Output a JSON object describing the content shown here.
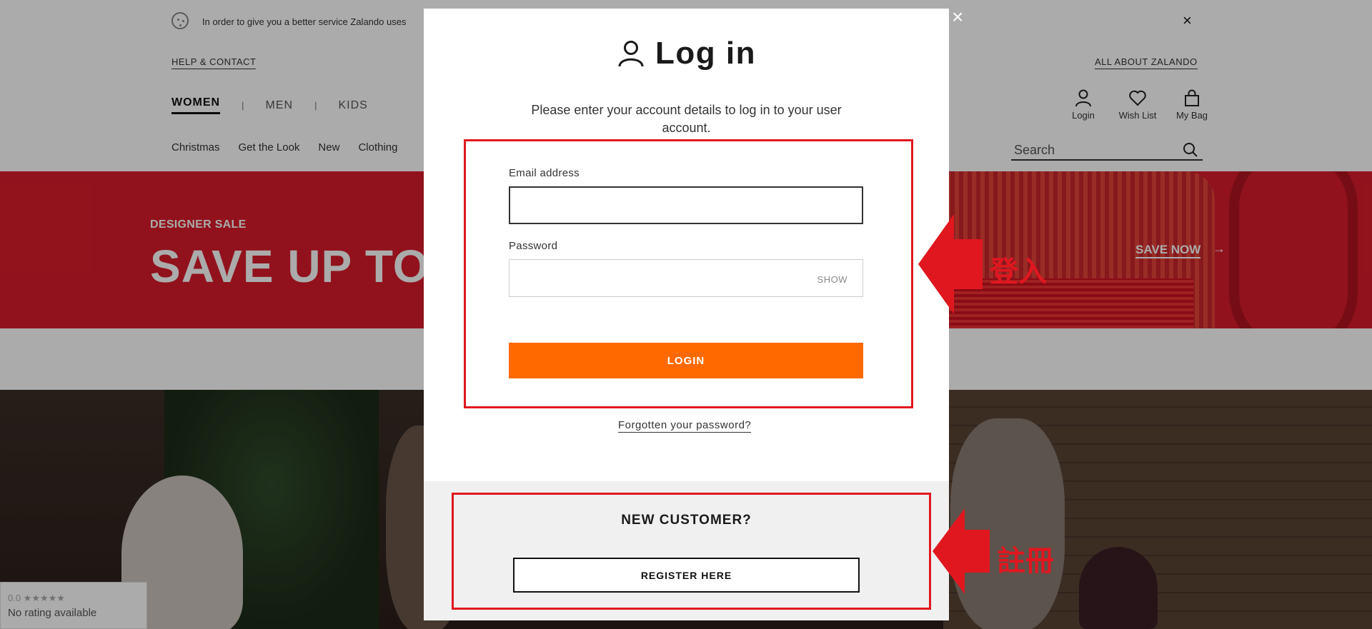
{
  "cookie": {
    "text": "In order to give you a better service Zalando uses"
  },
  "top_links": {
    "help": "HELP & CONTACT",
    "about": "ALL ABOUT ZALANDO"
  },
  "gender_tabs": [
    "WOMEN",
    "MEN",
    "KIDS"
  ],
  "separator": "|",
  "categories": [
    "Christmas",
    "Get the Look",
    "New",
    "Clothing"
  ],
  "header_icons": {
    "login": "Login",
    "wishlist": "Wish List",
    "bag": "My Bag"
  },
  "search": {
    "placeholder": "Search"
  },
  "banner": {
    "subtitle": "DESIGNER SALE",
    "title": "SAVE UP TO",
    "cta": "SAVE NOW",
    "cta_arrow": "→"
  },
  "rating": {
    "score": "0.0 ★★★★★",
    "text": "No rating available"
  },
  "modal": {
    "title": "Log in",
    "description": "Please enter your account details to log in to your user account.",
    "email_label": "Email address",
    "email_value": "",
    "password_label": "Password",
    "password_value": "",
    "show_label": "SHOW",
    "login_button": "LOGIN",
    "forgot_link": "Forgotten your password?",
    "new_customer": "NEW CUSTOMER?",
    "register_button": "REGISTER HERE",
    "close": "×"
  },
  "annotations": {
    "login": "登入",
    "register": "註冊",
    "color": "#e0171f"
  },
  "colors": {
    "login_button": "#ff6900",
    "banner": "#d91c2a"
  }
}
